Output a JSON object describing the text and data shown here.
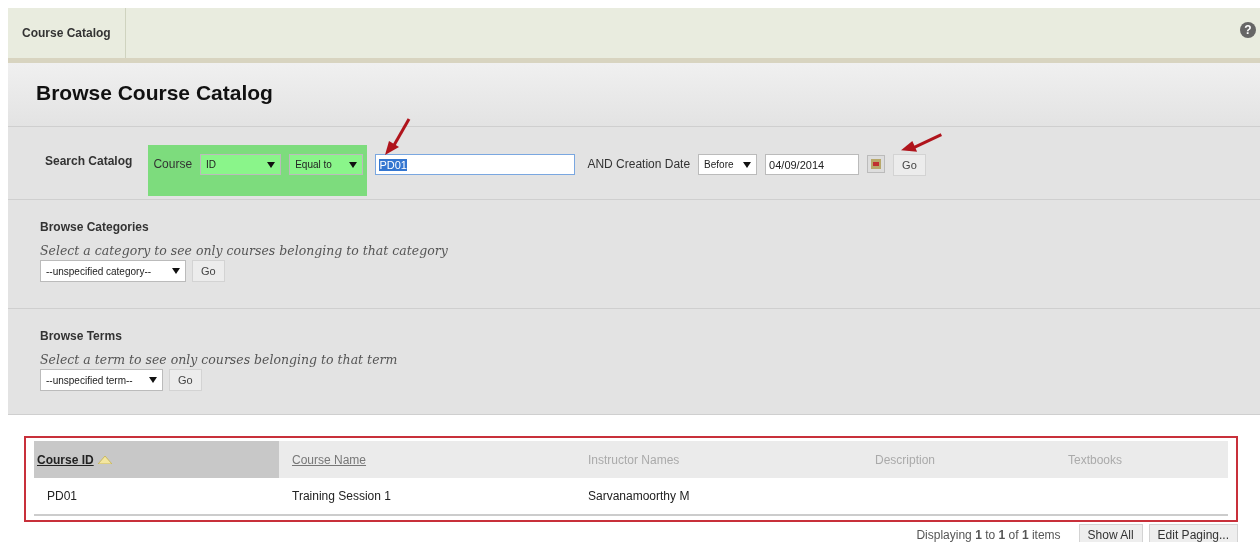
{
  "top_bar": {
    "tab": "Course Catalog",
    "help": "?"
  },
  "title": "Browse Course Catalog",
  "search": {
    "label": "Search Catalog",
    "highlighted": true,
    "field_label": "Course",
    "field_select": "ID",
    "operator_select": "Equal to",
    "value": "PD01",
    "value_selected": true,
    "date_label": "AND Creation Date",
    "date_operator": "Before",
    "date": "04/09/2014",
    "go": "Go"
  },
  "browse_sections": [
    {
      "title": "Browse Categories",
      "hint": "Select a category to see only courses belonging to that category",
      "select": "--unspecified category--",
      "go": "Go"
    },
    {
      "title": "Browse Terms",
      "hint": "Select a term to see only courses belonging to that term",
      "select": "--unspecified term--",
      "go": "Go"
    }
  ],
  "table": {
    "outlined": true,
    "columns": [
      {
        "label": "Course ID",
        "kind": "link",
        "selected": true
      },
      {
        "label": "Course Name",
        "kind": "link",
        "selected": false
      },
      {
        "label": "Instructor Names",
        "kind": "plain",
        "selected": false
      },
      {
        "label": "Description",
        "kind": "plain",
        "selected": false
      },
      {
        "label": "Textbooks",
        "kind": "plain",
        "selected": false
      }
    ],
    "rows": [
      [
        "PD01",
        "Training Session 1",
        "Sarvanamoorthy M"
      ]
    ]
  },
  "footer": {
    "status": "Displaying **1** to **1** of **1** items",
    "buttons": [
      "Show All",
      "Edit Paging..."
    ]
  }
}
